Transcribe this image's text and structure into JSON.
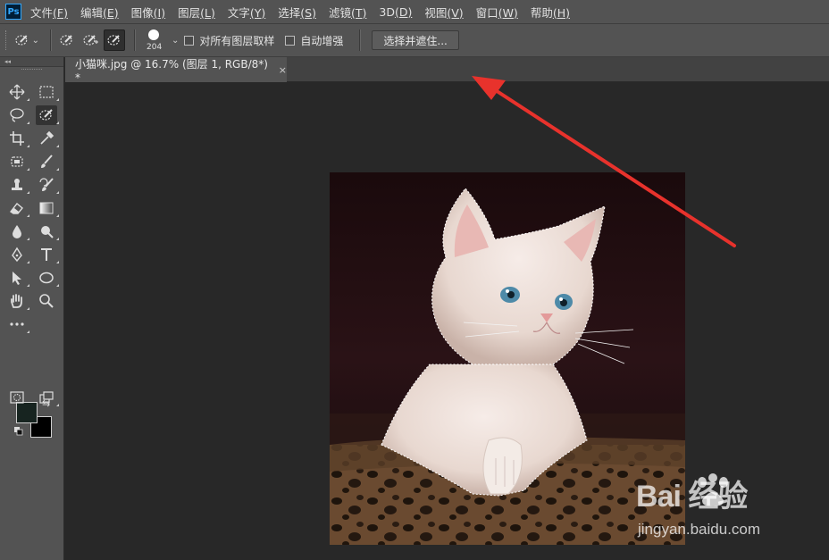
{
  "app": {
    "logo_text": "Ps"
  },
  "menu": [
    {
      "label": "文件",
      "key": "(F)"
    },
    {
      "label": "编辑",
      "key": "(E)"
    },
    {
      "label": "图像",
      "key": "(I)"
    },
    {
      "label": "图层",
      "key": "(L)"
    },
    {
      "label": "文字",
      "key": "(Y)"
    },
    {
      "label": "选择",
      "key": "(S)"
    },
    {
      "label": "滤镜",
      "key": "(T)"
    },
    {
      "label": "3D",
      "key": "(D)"
    },
    {
      "label": "视图",
      "key": "(V)"
    },
    {
      "label": "窗口",
      "key": "(W)"
    },
    {
      "label": "帮助",
      "key": "(H)"
    }
  ],
  "options": {
    "brush_size": "204",
    "sample_all_layers": "对所有图层取样",
    "auto_enhance": "自动增强",
    "select_and_mask": "选择并遮住..."
  },
  "document": {
    "tab_title": "小猫咪.jpg @ 16.7% (图层 1, RGB/8*) *",
    "close_glyph": "×"
  },
  "toolbar": {
    "collapse_glyph": "◂◂",
    "swap_glyph": "⇆"
  },
  "colors": {
    "foreground": "#172420",
    "background": "#000000",
    "annotation_arrow": "#e8322c"
  },
  "watermark": {
    "brand": "Bai 经验",
    "url": "jingyan.baidu.com"
  }
}
